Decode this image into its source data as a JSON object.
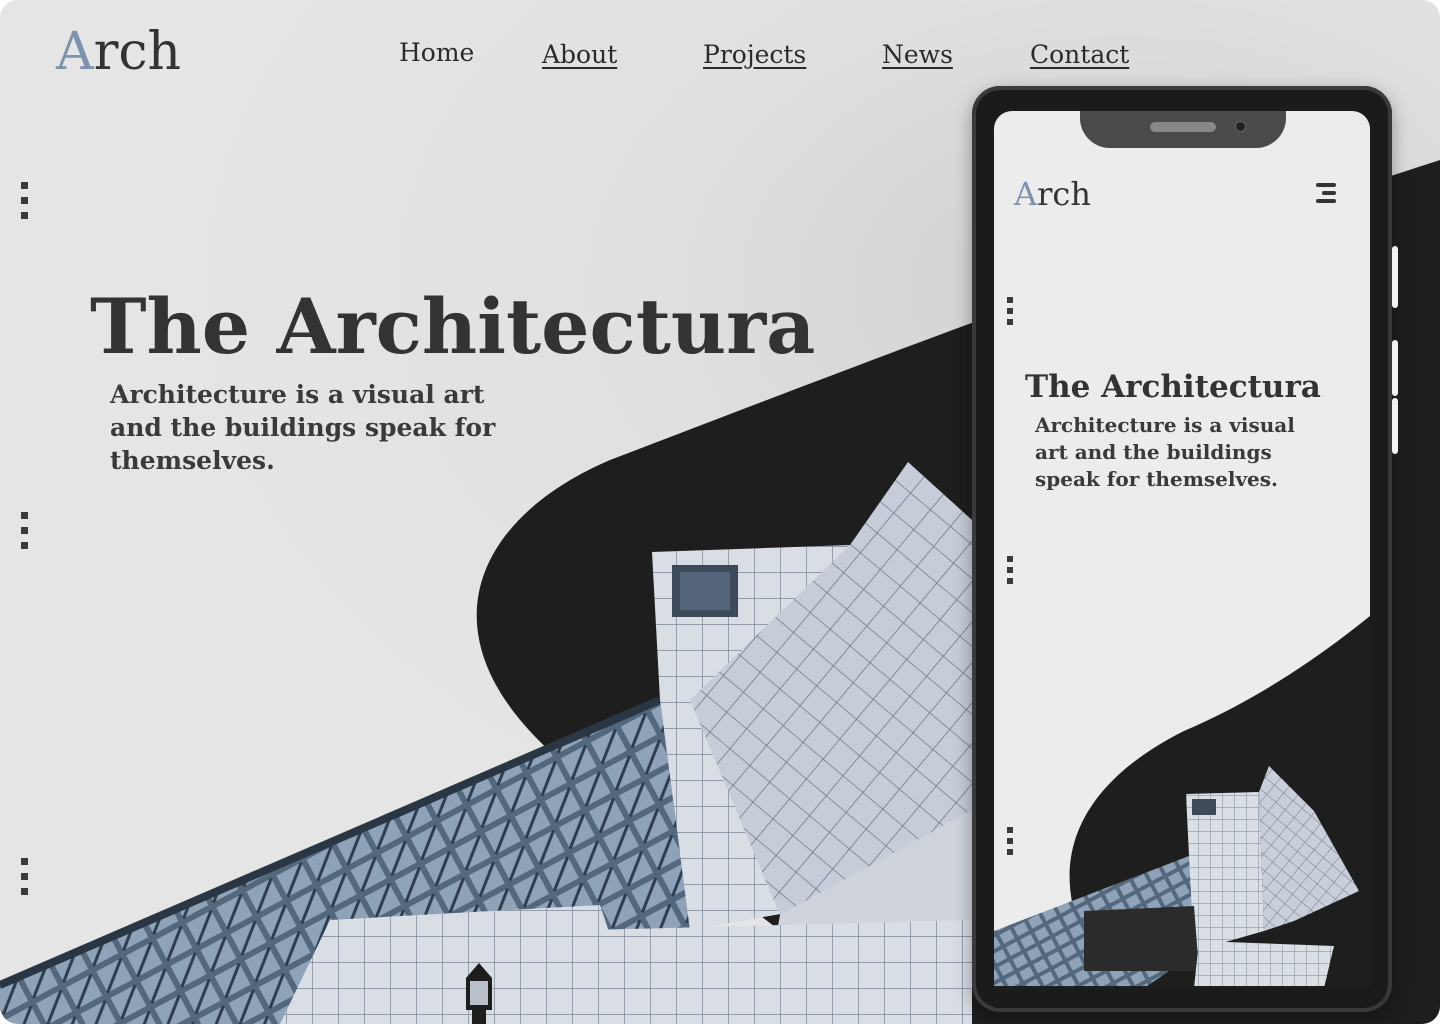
{
  "desktop": {
    "logo": {
      "accent_letter": "A",
      "rest": "rch"
    },
    "nav": {
      "home": "Home",
      "about": "About",
      "projects": "Projects",
      "news": "News",
      "contact": "Contact"
    },
    "hero": {
      "title": "The Architectura",
      "subtitle": "Architecture is a visual art and the buildings speak for themselves."
    }
  },
  "mobile": {
    "logo": {
      "accent_letter": "A",
      "rest": "rch"
    },
    "menu_icon": "hamburger-menu-icon",
    "hero": {
      "title": "The Architectura",
      "subtitle": "Architecture is a visual art and the buildings speak for themselves."
    }
  },
  "colors": {
    "background": "#e5e5e5",
    "dark_shape": "#1e1e1e",
    "text": "#333333",
    "logo_accent": "#7d93ad",
    "building_tile": "#c5cbd6",
    "building_glass": "#3d5066"
  },
  "icons": [
    "vertical-dots-icon",
    "hamburger-menu-icon"
  ]
}
